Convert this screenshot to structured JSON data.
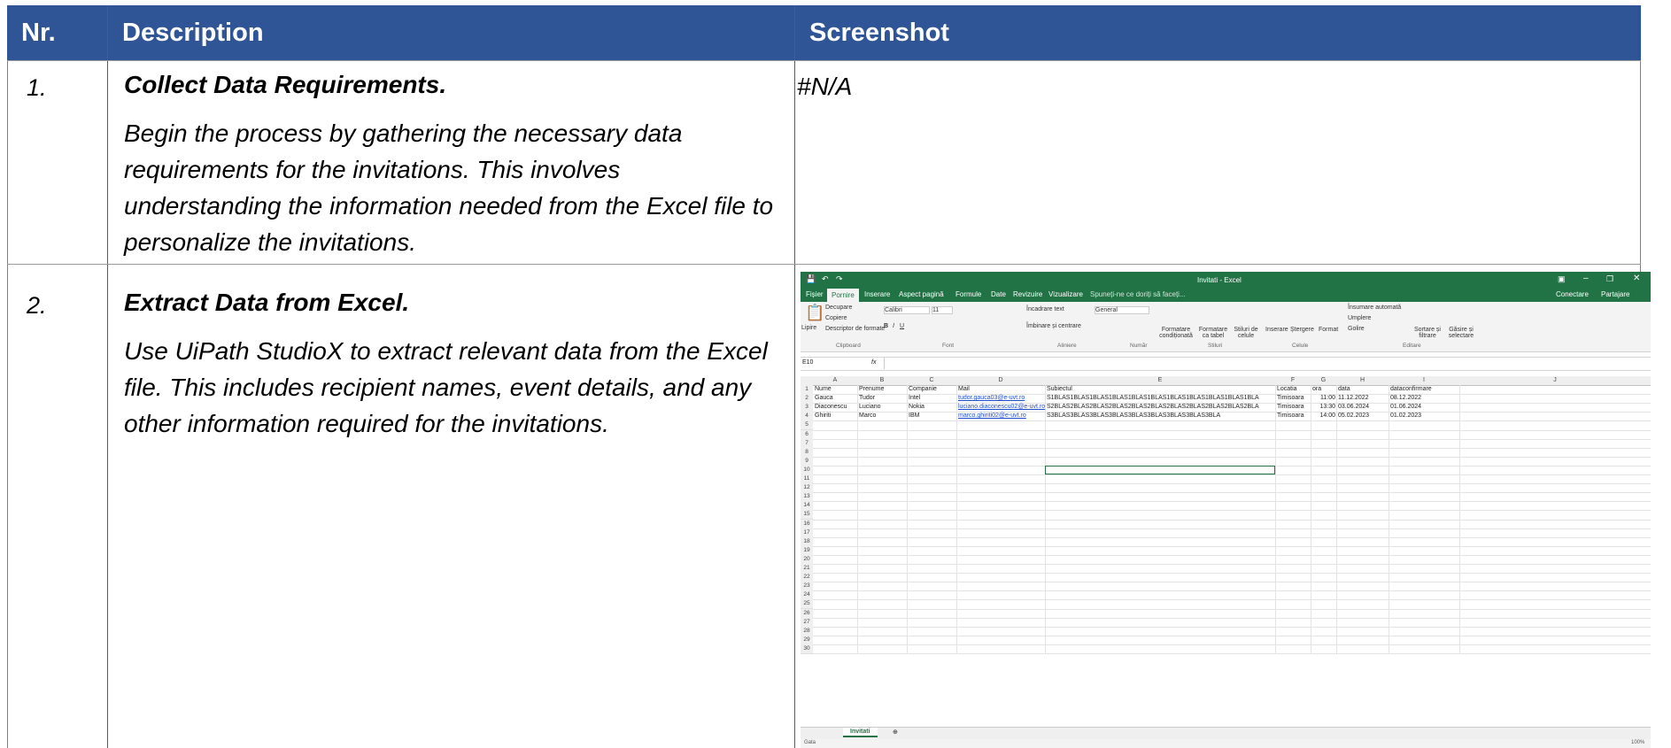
{
  "table": {
    "headers": [
      "Nr.",
      "Description",
      "Screenshot"
    ],
    "rows": [
      {
        "nr": "1.",
        "title": "Collect Data Requirements.",
        "body": "Begin the process by gathering the necessary data requirements for the invitations. This involves understanding the information needed from the Excel file to personalize the invitations.",
        "screenshot_text": "#N/A"
      },
      {
        "nr": "2.",
        "title": "Extract Data from Excel.",
        "body": "Use UiPath StudioX to extract relevant data from the Excel file. This includes recipient names, event details, and any other information required for the invitations."
      }
    ]
  },
  "excel": {
    "window_title": "Invitati - Excel",
    "tabs": [
      "Fișier",
      "Pornire",
      "Inserare",
      "Aspect pagină",
      "Formule",
      "Date",
      "Revizuire",
      "Vizualizare",
      "Spuneți-ne ce doriți să faceți..."
    ],
    "account": [
      "Conectare",
      "Partajare"
    ],
    "ribbon": {
      "paste": "Lipire",
      "cut": "Decupare",
      "copy": "Copiere",
      "format_painter": "Descriptor de formate",
      "font_name": "Calibri",
      "font_size": "11",
      "wrap_text": "Încadrare text",
      "merge": "Îmbinare și centrare",
      "number_format": "General",
      "cond_format": "Formatare condiționată",
      "format_table": "Formatare ca tabel",
      "cell_styles": "Stiluri de celule",
      "insert": "Inserare",
      "delete": "Ștergere",
      "format": "Format",
      "autosum": "Însumare automată",
      "fill": "Umplere",
      "clear": "Golire",
      "sort": "Sortare și filtrare",
      "find": "Găsire și selectare",
      "groups": [
        "Clipboard",
        "Font",
        "Aliniere",
        "Număr",
        "Stiluri",
        "Celule",
        "Editare"
      ]
    },
    "name_box": "E10",
    "fx": "fx",
    "columns": [
      "A",
      "B",
      "C",
      "D",
      "E",
      "F",
      "G",
      "H",
      "I",
      "J"
    ],
    "rows": [
      [
        "Nume",
        "Prenume",
        "Companie",
        "Mail",
        "Subiectul",
        "Locatia",
        "ora",
        "data",
        "dataconfirmare"
      ],
      [
        "Gauca",
        "Tudor",
        "Intel",
        "tudor.gauca03@e-uvt.ro",
        "S1BLAS1BLAS1BLAS1BLAS1BLAS1BLAS1BLAS1BLAS1BLAS1BLAS1BLA",
        "Timisoara",
        "11:00",
        "11.12.2022",
        "08.12.2022"
      ],
      [
        "Diaconescu",
        "Luciano",
        "Nokia",
        "luciano.diaconescu02@e-uvt.ro",
        "S2BLAS2BLAS2BLAS2BLAS2BLAS2BLAS2BLAS2BLAS2BLAS2BLAS2BLA",
        "Timisoara",
        "13:30",
        "03.06.2024",
        "01.06.2024"
      ],
      [
        "Ghiriti",
        "Marco",
        "IBM",
        "marco.ghiriti02@e-uvt.ro",
        "S3BLAS3BLAS3BLAS3BLAS3BLAS3BLAS3BLAS3BLAS3BLA",
        "Timisoara",
        "14:00",
        "05.02.2023",
        "01.02.2023"
      ]
    ],
    "row_numbers": [
      "1",
      "2",
      "3",
      "4",
      "5",
      "6",
      "7",
      "8",
      "9",
      "10",
      "11",
      "12",
      "13",
      "14",
      "15",
      "16",
      "17",
      "18",
      "19",
      "20",
      "21",
      "22",
      "23",
      "24",
      "25",
      "26",
      "27",
      "28",
      "29",
      "30"
    ],
    "sheet_tab": "Invitati",
    "status": "Gata",
    "zoom": "100%"
  }
}
